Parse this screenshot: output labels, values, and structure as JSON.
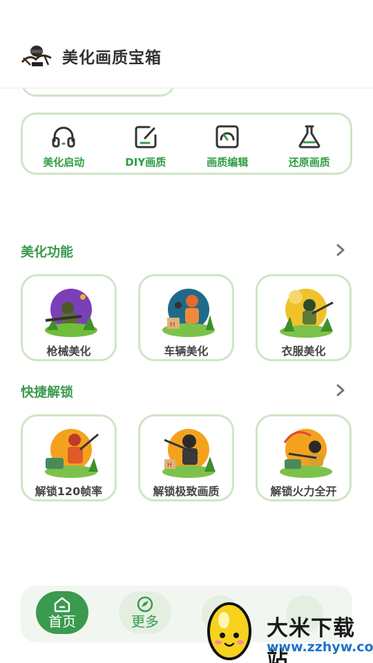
{
  "header": {
    "title": "美化画质宝箱"
  },
  "tools": [
    {
      "label": "美化启动",
      "icon": "headphones-icon"
    },
    {
      "label": "DIY画质",
      "icon": "edit-square-icon"
    },
    {
      "label": "画质编辑",
      "icon": "gauge-icon"
    },
    {
      "label": "还原画质",
      "icon": "flask-icon"
    }
  ],
  "sections": {
    "beautify": {
      "title": "美化功能",
      "items": [
        {
          "label": "枪械美化"
        },
        {
          "label": "车辆美化"
        },
        {
          "label": "衣服美化"
        }
      ]
    },
    "unlock": {
      "title": "快捷解锁",
      "items": [
        {
          "label": "解锁120帧率"
        },
        {
          "label": "解锁极致画质"
        },
        {
          "label": "解锁火力全开"
        }
      ]
    }
  },
  "nav": {
    "home_label": "首页",
    "more_label": "更多"
  },
  "watermark": {
    "brand": "大米下载站",
    "url": "www.zzhyw.com"
  },
  "colors": {
    "accent": "#3a9a4e",
    "border": "#cfe5c8"
  }
}
